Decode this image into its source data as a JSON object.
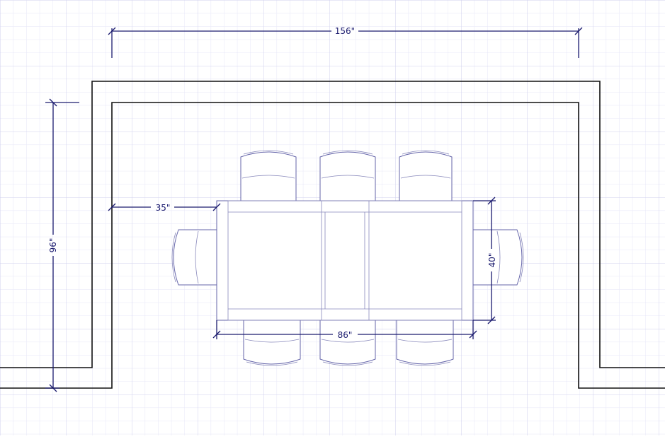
{
  "colors": {
    "grid_minor": "#e6e6f7",
    "grid_major": "#cfcfee",
    "dimension": "#1a1a6e",
    "wall": "#111111",
    "furniture": "#6666aa"
  },
  "dimensions": {
    "room_width": "156\"",
    "room_depth": "96\"",
    "clearance": "35\"",
    "table_length": "86\"",
    "table_width": "40\""
  }
}
